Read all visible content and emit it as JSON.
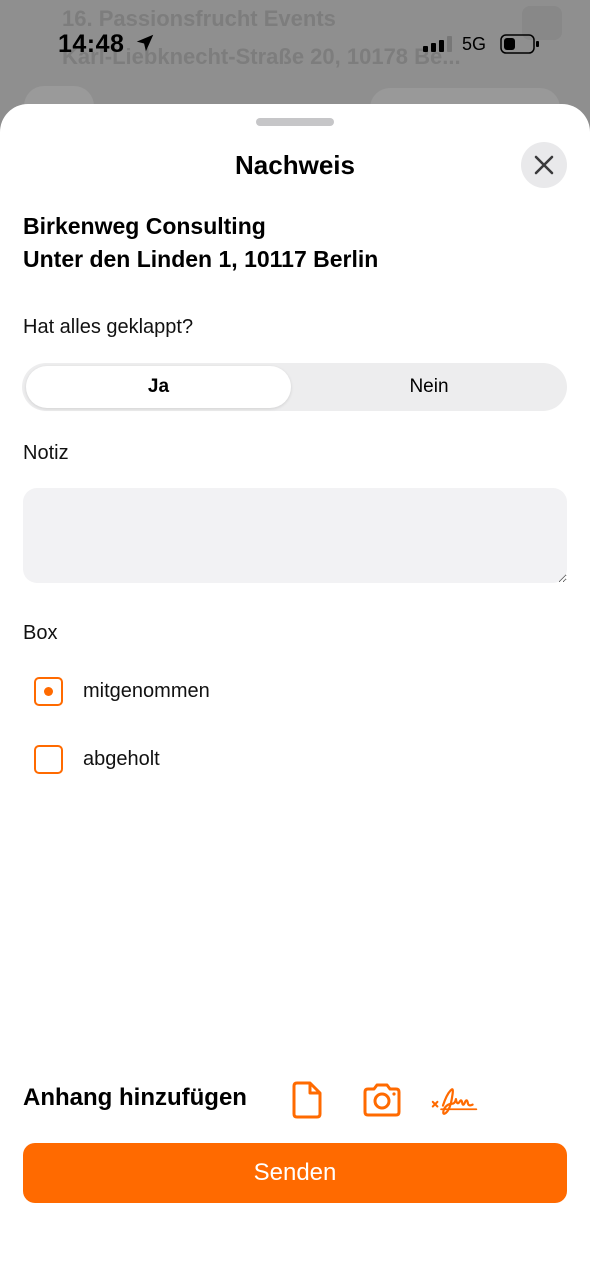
{
  "background": {
    "row1": "16. Passionsfrucht Events",
    "row2": "Karl-Liebknecht-Straße 20, 10178 Be..."
  },
  "status_bar": {
    "time": "14:48",
    "network": "5G",
    "location_icon": "location-arrow-icon",
    "signal_icon": "cellular-signal-icon",
    "battery_icon": "battery-icon"
  },
  "sheet": {
    "title": "Nachweis",
    "close_icon": "close-icon",
    "company_name": "Birkenweg Consulting",
    "company_address": "Unter den Linden 1, 10117 Berlin",
    "question": "Hat alles geklappt?",
    "segmented": {
      "options": [
        "Ja",
        "Nein"
      ],
      "selected": "Ja"
    },
    "note_label": "Notiz",
    "note_value": "",
    "box_label": "Box",
    "box_options": [
      {
        "label": "mitgenommen",
        "checked": true
      },
      {
        "label": "abgeholt",
        "checked": false
      }
    ],
    "attachment_label": "Anhang hinzufügen",
    "attachment_icons": [
      "document-icon",
      "camera-icon",
      "signature-icon"
    ],
    "send_label": "Senden"
  },
  "colors": {
    "accent": "#ff6a00",
    "segment_bg": "#ededee",
    "field_bg": "#f2f2f4"
  }
}
